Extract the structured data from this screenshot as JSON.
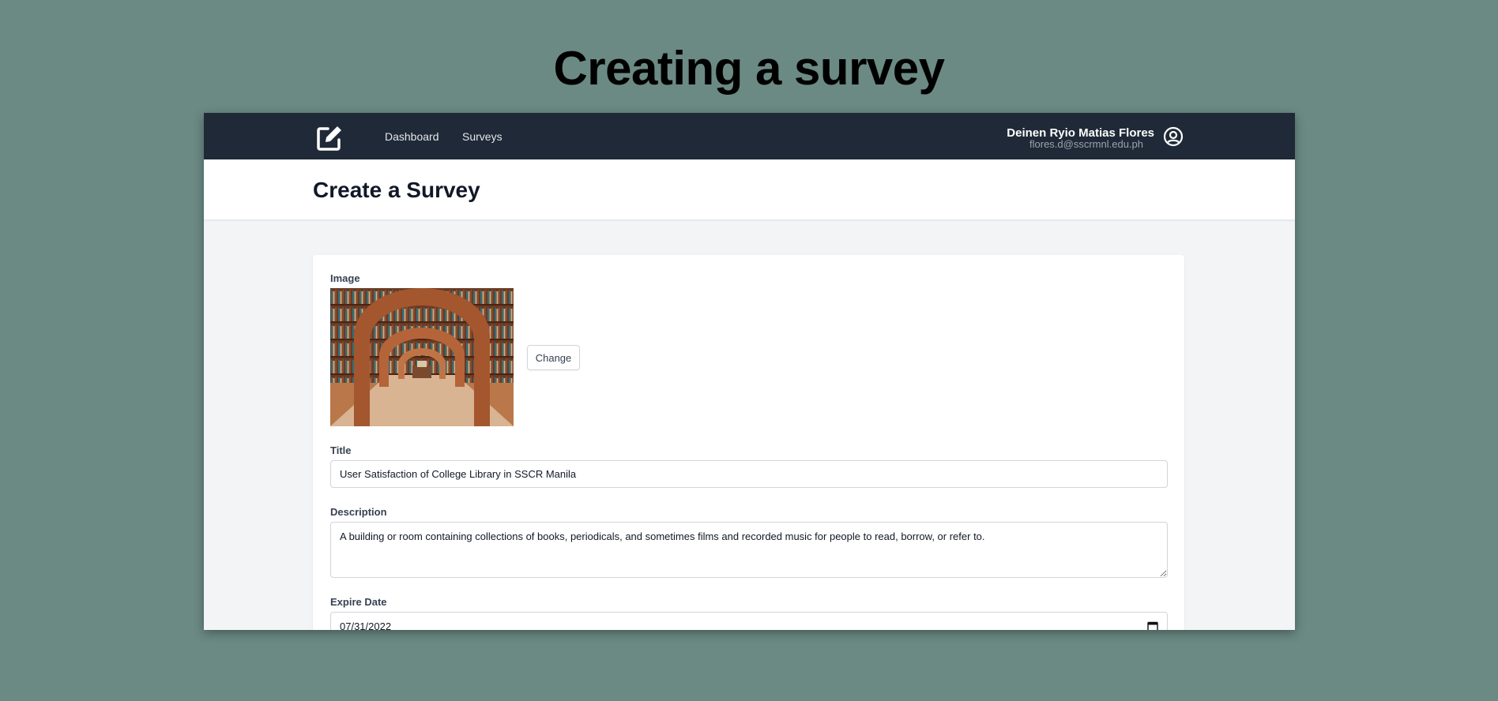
{
  "headline": "Creating a survey",
  "nav": {
    "links": [
      "Dashboard",
      "Surveys"
    ],
    "user_name": "Deinen Ryio Matias Flores",
    "user_email": "flores.d@sscrmnl.edu.ph"
  },
  "page": {
    "title": "Create a Survey"
  },
  "form": {
    "image_label": "Image",
    "change_label": "Change",
    "title_label": "Title",
    "title_value": "User Satisfaction of College Library in SSCR Manila",
    "description_label": "Description",
    "description_value": "A building or room containing collections of books, periodicals, and sometimes films and recorded music for people to read, borrow, or refer to.",
    "expire_label": "Expire Date",
    "expire_value": "07/31/2022"
  },
  "icons": {
    "logo": "edit-icon",
    "user": "user-circle-icon",
    "date": "calendar-icon"
  },
  "colors": {
    "background": "#6b8a83",
    "navbar": "#1f2937",
    "page_bg": "#f3f4f6"
  }
}
